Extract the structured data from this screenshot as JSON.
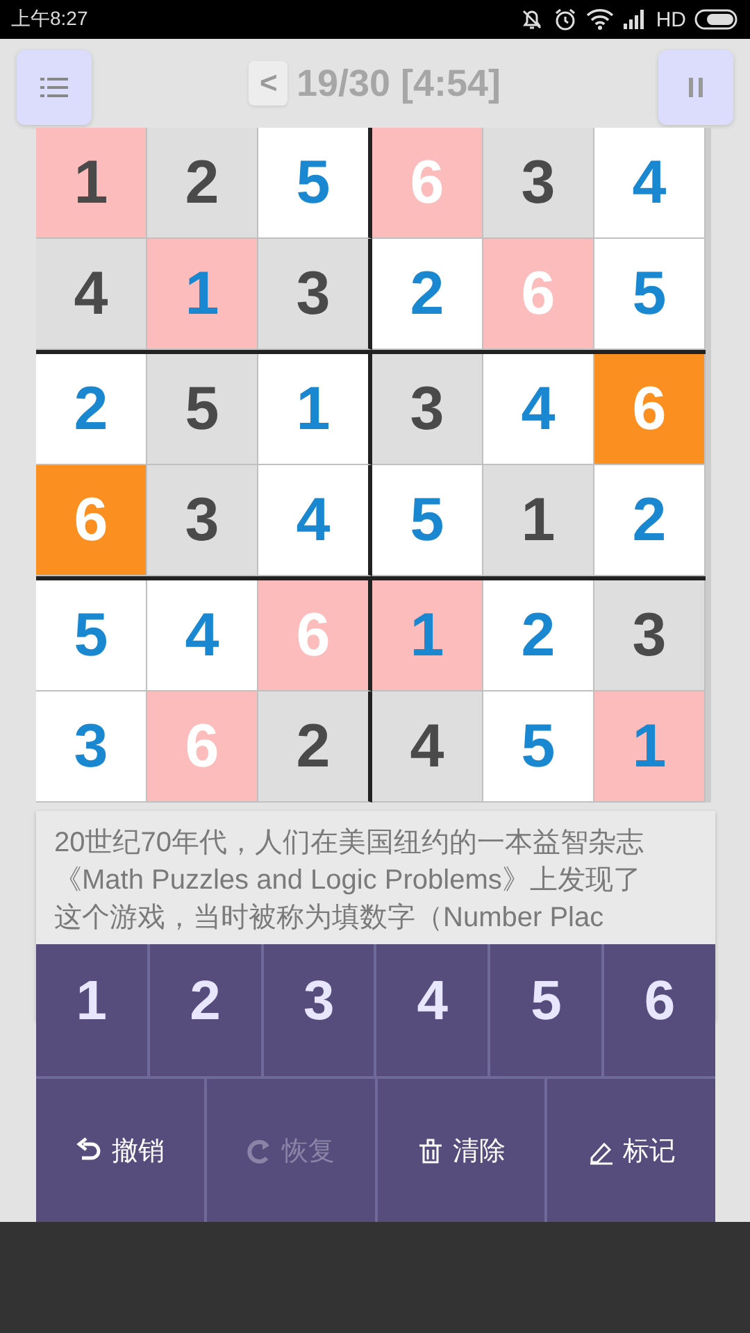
{
  "status_bar": {
    "time": "上午8:27",
    "network": "HD"
  },
  "header": {
    "back": "<",
    "title": "19/30 [4:54]"
  },
  "board": {
    "rows": [
      [
        {
          "value": "1",
          "kind": "given",
          "color": "#fcbcbc"
        },
        {
          "value": "2",
          "kind": "given",
          "color": "#dedede"
        },
        {
          "value": "5",
          "kind": "entered",
          "color": "#ffffff"
        },
        {
          "value": "6",
          "kind": "marked",
          "color": "#fcbcbc"
        },
        {
          "value": "3",
          "kind": "given",
          "color": "#dedede"
        },
        {
          "value": "4",
          "kind": "entered",
          "color": "#ffffff"
        }
      ],
      [
        {
          "value": "4",
          "kind": "given",
          "color": "#dedede"
        },
        {
          "value": "1",
          "kind": "entered",
          "color": "#fcbcbc"
        },
        {
          "value": "3",
          "kind": "given",
          "color": "#dedede"
        },
        {
          "value": "2",
          "kind": "entered",
          "color": "#ffffff"
        },
        {
          "value": "6",
          "kind": "marked",
          "color": "#fcbcbc"
        },
        {
          "value": "5",
          "kind": "entered",
          "color": "#ffffff"
        }
      ],
      [
        {
          "value": "2",
          "kind": "entered",
          "color": "#ffffff"
        },
        {
          "value": "5",
          "kind": "given",
          "color": "#dedede"
        },
        {
          "value": "1",
          "kind": "entered",
          "color": "#ffffff"
        },
        {
          "value": "3",
          "kind": "given",
          "color": "#dedede"
        },
        {
          "value": "4",
          "kind": "entered",
          "color": "#ffffff"
        },
        {
          "value": "6",
          "kind": "marked",
          "color": "#fb8f1f"
        }
      ],
      [
        {
          "value": "6",
          "kind": "marked",
          "color": "#fb8f1f"
        },
        {
          "value": "3",
          "kind": "given",
          "color": "#dedede"
        },
        {
          "value": "4",
          "kind": "entered",
          "color": "#ffffff"
        },
        {
          "value": "5",
          "kind": "entered",
          "color": "#ffffff"
        },
        {
          "value": "1",
          "kind": "given",
          "color": "#dedede"
        },
        {
          "value": "2",
          "kind": "entered",
          "color": "#ffffff"
        }
      ],
      [
        {
          "value": "5",
          "kind": "entered",
          "color": "#ffffff"
        },
        {
          "value": "4",
          "kind": "entered",
          "color": "#ffffff"
        },
        {
          "value": "6",
          "kind": "marked",
          "color": "#fcbcbc"
        },
        {
          "value": "1",
          "kind": "entered",
          "color": "#fcbcbc"
        },
        {
          "value": "2",
          "kind": "entered",
          "color": "#ffffff"
        },
        {
          "value": "3",
          "kind": "given",
          "color": "#dedede"
        }
      ],
      [
        {
          "value": "3",
          "kind": "entered",
          "color": "#ffffff"
        },
        {
          "value": "6",
          "kind": "marked",
          "color": "#fcbcbc"
        },
        {
          "value": "2",
          "kind": "given",
          "color": "#dedede"
        },
        {
          "value": "4",
          "kind": "given",
          "color": "#dedede"
        },
        {
          "value": "5",
          "kind": "entered",
          "color": "#ffffff"
        },
        {
          "value": "1",
          "kind": "entered",
          "color": "#fcbcbc"
        }
      ]
    ]
  },
  "info_lines": [
    "20世纪70年代，人们在美国纽约的一本益智杂志",
    "《Math Puzzles and Logic Problems》上发现了",
    "这个游戏，当时被称为填数字（Number Plac"
  ],
  "keypad": {
    "digits": [
      "1",
      "2",
      "3",
      "4",
      "5",
      "6"
    ],
    "actions": [
      {
        "kind": "undo",
        "label": "撤销",
        "disabled": false
      },
      {
        "kind": "redo",
        "label": "恢复",
        "disabled": true
      },
      {
        "kind": "clear",
        "label": "清除",
        "disabled": false
      },
      {
        "kind": "note",
        "label": "标记",
        "disabled": false
      }
    ]
  }
}
